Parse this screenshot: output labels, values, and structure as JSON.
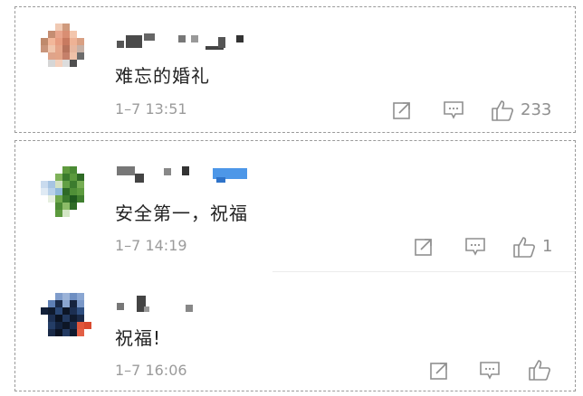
{
  "comments": [
    {
      "text": "难忘的婚礼",
      "time": "1–7 13:51",
      "likes": "233",
      "icons": [
        "share-icon",
        "comment-icon",
        "like-icon"
      ],
      "avatar_colors": [
        "#f2d3c3",
        "#c99277",
        "#e7a58b",
        "#f4c2a6",
        "#b2745e",
        "#d9d9d9",
        "#6e6e6e"
      ]
    },
    {
      "text": "安全第一，祝福",
      "time": "1–7 14:19",
      "likes": "1",
      "icons": [
        "share-icon",
        "comment-icon",
        "like-icon"
      ],
      "avatar_colors": [
        "#3f7f2f",
        "#69a84f",
        "#a9c8e6",
        "#1f5b26",
        "#cde3c0",
        "#ffffff"
      ]
    },
    {
      "text": "祝福!",
      "time": "1–7 16:06",
      "likes": "",
      "icons": [
        "share-icon",
        "comment-icon",
        "like-icon"
      ],
      "avatar_colors": [
        "#1c2f52",
        "#2a4775",
        "#8fa7cf",
        "#0d1626",
        "#e0563b",
        "#ffffff"
      ]
    }
  ]
}
